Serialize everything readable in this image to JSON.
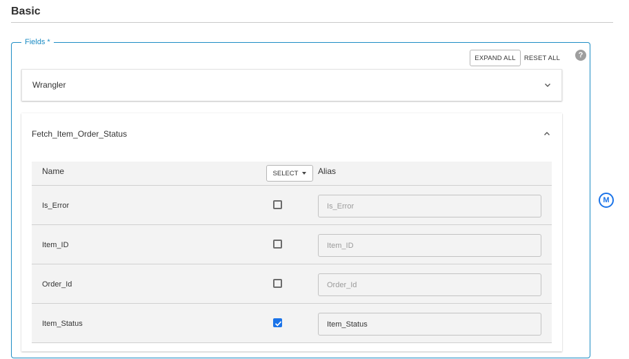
{
  "section": {
    "title": "Basic"
  },
  "fields": {
    "legend": "Fields *",
    "expand_all_label": "EXPAND ALL",
    "reset_all_label": "RESET ALL",
    "help_icon": "help-circle-icon"
  },
  "panels": [
    {
      "title": "Wrangler",
      "expanded": false
    },
    {
      "title": "Fetch_Item_Order_Status",
      "expanded": true
    }
  ],
  "table": {
    "name_header": "Name",
    "select_label": "SELECT",
    "alias_header": "Alias",
    "rows": [
      {
        "name": "Is_Error",
        "checked": false,
        "alias_value": "",
        "alias_placeholder": "Is_Error"
      },
      {
        "name": "Item_ID",
        "checked": false,
        "alias_value": "",
        "alias_placeholder": "Item_ID"
      },
      {
        "name": "Order_Id",
        "checked": false,
        "alias_value": "",
        "alias_placeholder": "Order_Id"
      },
      {
        "name": "Item_Status",
        "checked": true,
        "alias_value": "Item_Status",
        "alias_placeholder": "Item_Status"
      }
    ]
  },
  "macro_icon": {
    "label": "M"
  },
  "colors": {
    "accent": "#1a8bc4",
    "checkbox": "#1a73e8",
    "table_bg": "#f3f3f3"
  }
}
